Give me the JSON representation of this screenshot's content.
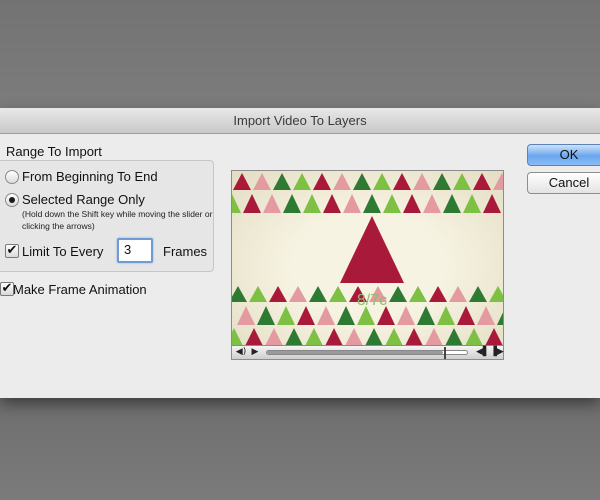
{
  "dialog": {
    "title": "Import Video To Layers",
    "range_group": {
      "label": "Range To Import",
      "option_all": "From Beginning To End",
      "option_selected": "Selected Range Only",
      "selected_hint": "(Hold down the Shift key while moving the slider or clicking the arrows)",
      "selected_option": "option_selected"
    },
    "limit": {
      "label": "Limit To Every",
      "checked": true,
      "value": "3",
      "unit": "Frames"
    },
    "frame_animation": {
      "label": "Make Frame Animation",
      "checked": true
    },
    "buttons": {
      "ok": "OK",
      "cancel": "Cancel"
    },
    "preview": {
      "overlay_text": "8/7c",
      "playhead_fraction": 0.88,
      "icons": [
        "speaker-icon",
        "play-icon",
        "step-back-icon",
        "step-forward-icon"
      ]
    },
    "colors": {
      "primary_button": "#6aa6ee",
      "triangle_red": "#a8193a",
      "triangle_green": "#7ec043",
      "triangle_dark_green": "#2f7a33",
      "triangle_pink": "#e39aa1",
      "preview_bg": "#f2eedc"
    }
  }
}
